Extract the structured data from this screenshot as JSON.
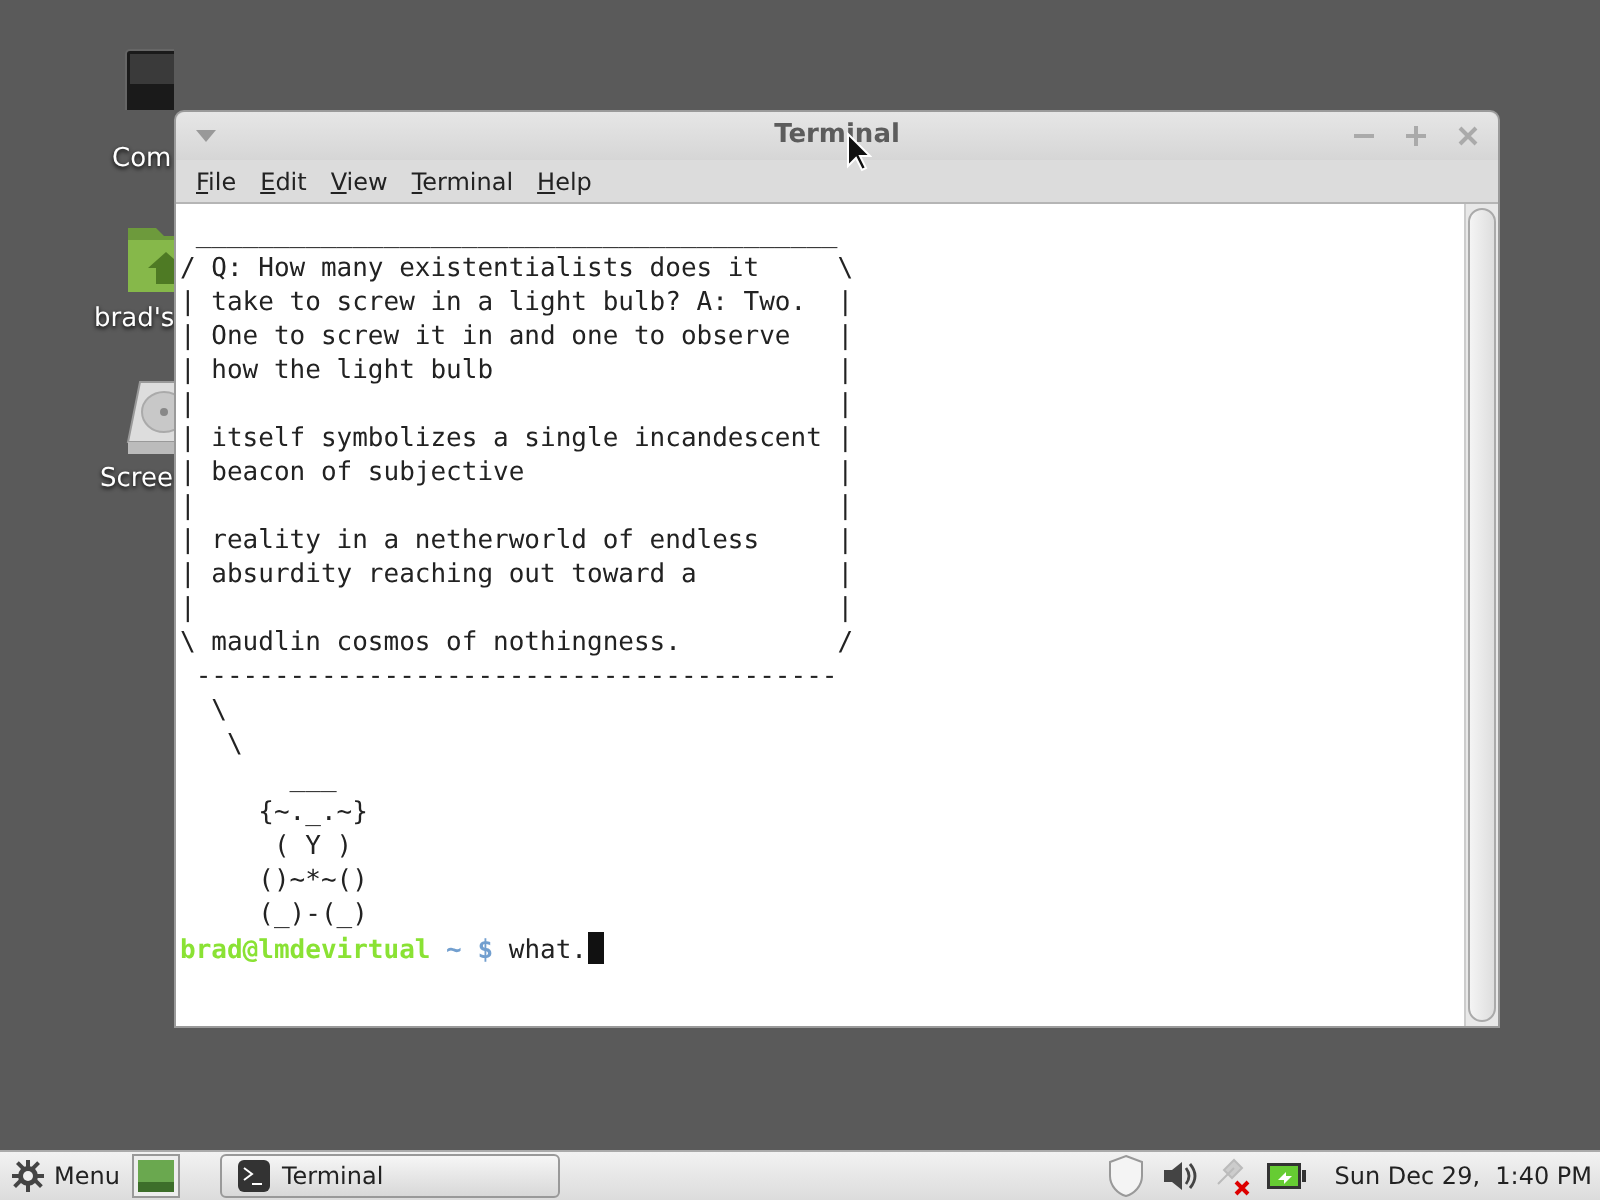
{
  "desktop_icons": [
    {
      "kind": "monitor",
      "label": "Com"
    },
    {
      "kind": "folder",
      "label": "brad's"
    },
    {
      "kind": "drive",
      "label": "Scree"
    }
  ],
  "window": {
    "title": "Terminal",
    "menu": [
      "File",
      "Edit",
      "View",
      "Terminal",
      "Help"
    ],
    "terminal": {
      "lines": [
        " _________________________________________",
        "/ Q: How many existentialists does it     \\",
        "| take to screw in a light bulb? A: Two.  |",
        "| One to screw it in and one to observe   |",
        "| how the light bulb                      |",
        "|                                         |",
        "| itself symbolizes a single incandescent |",
        "| beacon of subjective                    |",
        "|                                         |",
        "| reality in a netherworld of endless     |",
        "| absurdity reaching out toward a         |",
        "|                                         |",
        "\\ maudlin cosmos of nothingness.          /",
        " -----------------------------------------",
        "  \\",
        "   \\",
        "       ___",
        "     {~._.~}",
        "      ( Y )",
        "     ()~*~()",
        "     (_)-(_)"
      ],
      "prompt": {
        "user_host": "brad@lmdevirtual",
        "path": " ~ $",
        "command": " what."
      }
    }
  },
  "taskbar": {
    "menu_label": "Menu",
    "tasks": [
      {
        "label": "Terminal",
        "selected": false
      }
    ],
    "clock": "Sun Dec 29,  1:40 PM"
  }
}
